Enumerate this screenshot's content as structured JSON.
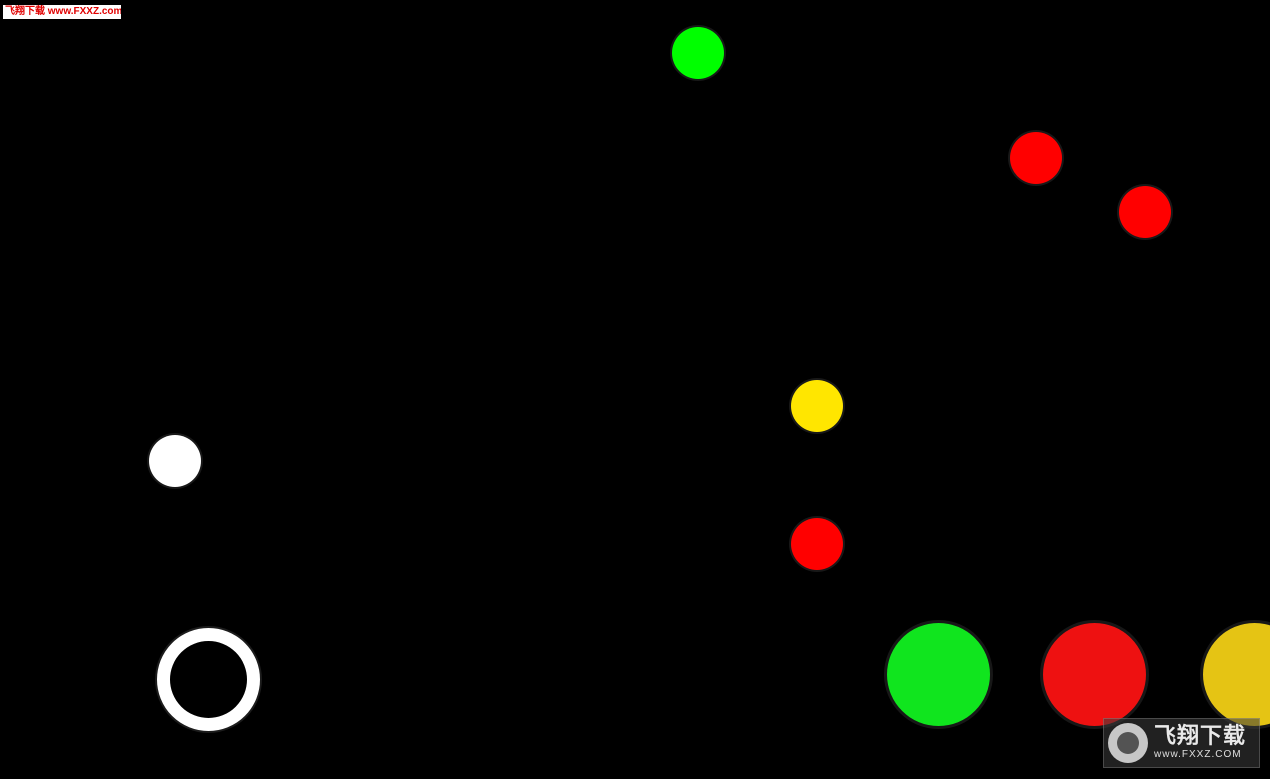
{
  "watermarks": {
    "top_left_text": "飞翔下载 www.FXXZ.com",
    "bottom_right_title": "飞翔下载",
    "bottom_right_url": "www.FXXZ.COM"
  },
  "colors": {
    "background": "#000000",
    "green": "#00ff00",
    "red": "#ff0000",
    "yellow": "#ffe600",
    "white": "#ffffff",
    "button_green": "#10e51e",
    "button_red": "#ee1111",
    "button_yellow": "#e5c414"
  },
  "falling_dots": [
    {
      "color": "green"
    },
    {
      "color": "red"
    },
    {
      "color": "red"
    },
    {
      "color": "yellow"
    },
    {
      "color": "white"
    },
    {
      "color": "red"
    }
  ],
  "player": {
    "icon": "ring-icon"
  },
  "color_buttons": [
    {
      "color": "green"
    },
    {
      "color": "red"
    },
    {
      "color": "yellow"
    }
  ]
}
